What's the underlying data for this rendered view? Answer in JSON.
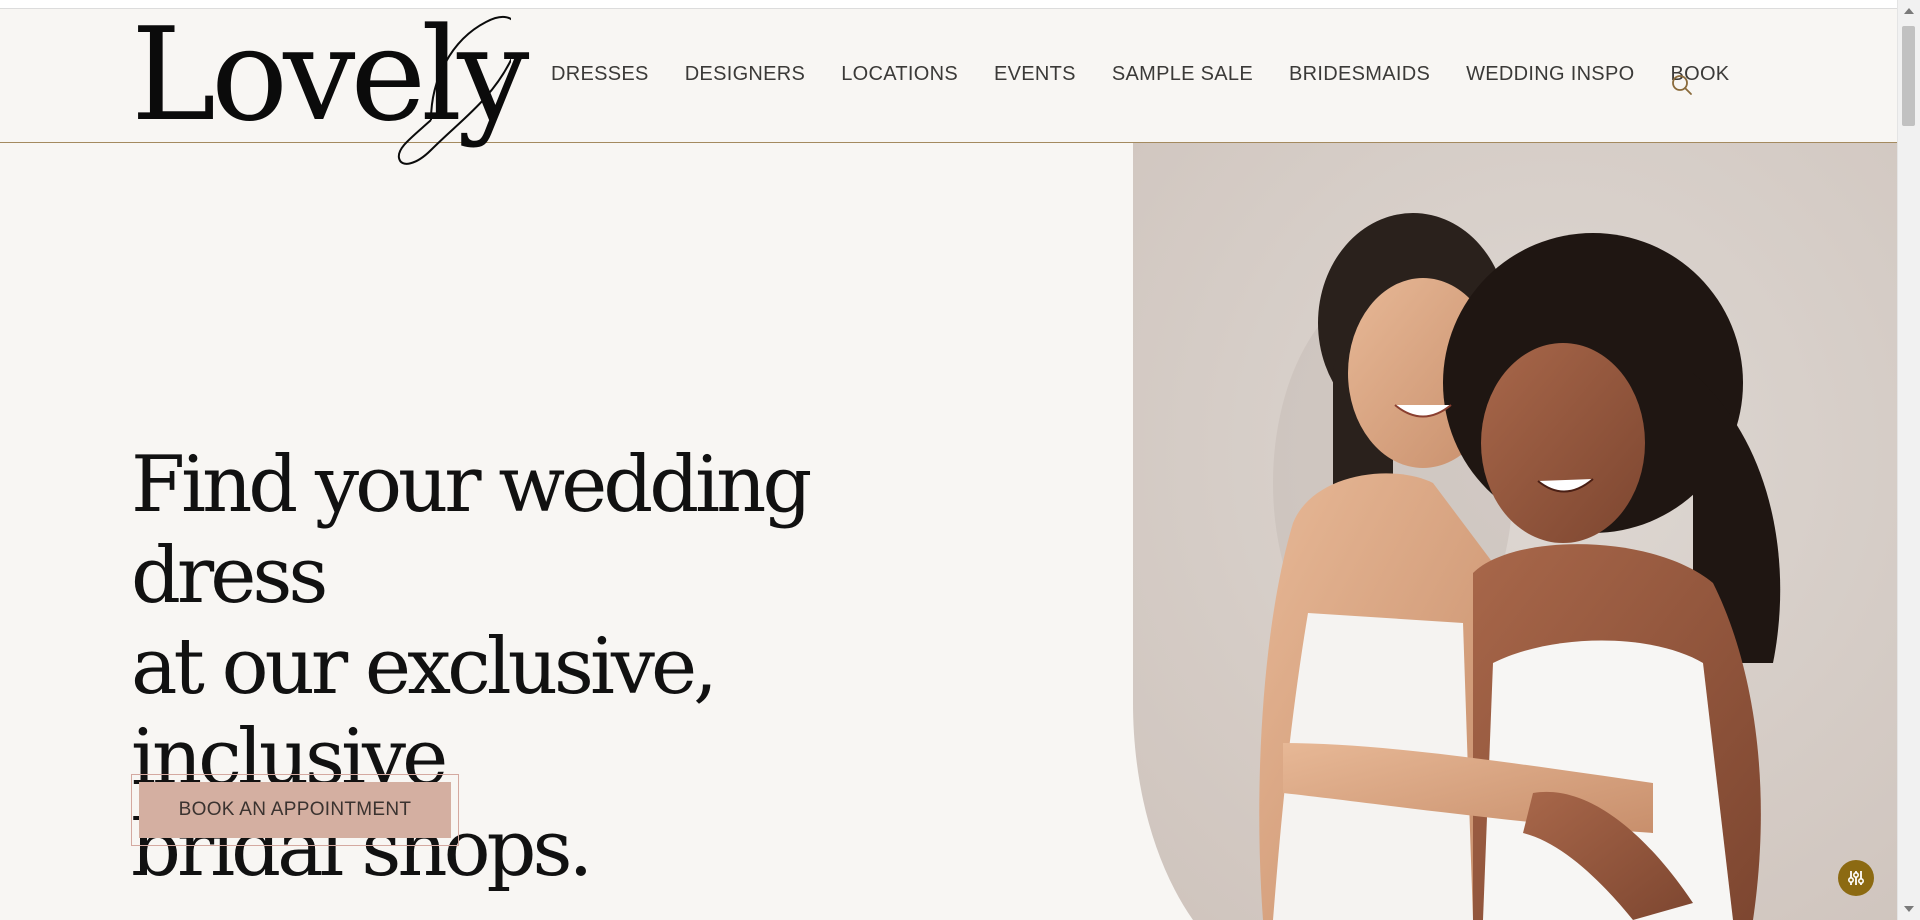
{
  "brand": {
    "logo_text": "Lovely"
  },
  "nav": {
    "items": [
      {
        "label": "DRESSES"
      },
      {
        "label": "DESIGNERS"
      },
      {
        "label": "LOCATIONS"
      },
      {
        "label": "EVENTS"
      },
      {
        "label": "SAMPLE SALE"
      },
      {
        "label": "BRIDESMAIDS"
      },
      {
        "label": "WEDDING INSPO"
      },
      {
        "label": "BOOK"
      }
    ],
    "search_icon": "search-icon"
  },
  "hero": {
    "headline_lines": [
      "Find your wedding dress",
      "at our exclusive, inclusive",
      "bridal shops."
    ],
    "cta_label": "BOOK AN APPOINTMENT"
  },
  "accessibility": {
    "icon": "sliders-icon"
  },
  "colors": {
    "background": "#f8f6f3",
    "accent_gold": "#a48a5f",
    "cta_fill": "#d4afa1",
    "cta_border": "#d4a9a0",
    "widget_gold": "#8c6a12"
  }
}
